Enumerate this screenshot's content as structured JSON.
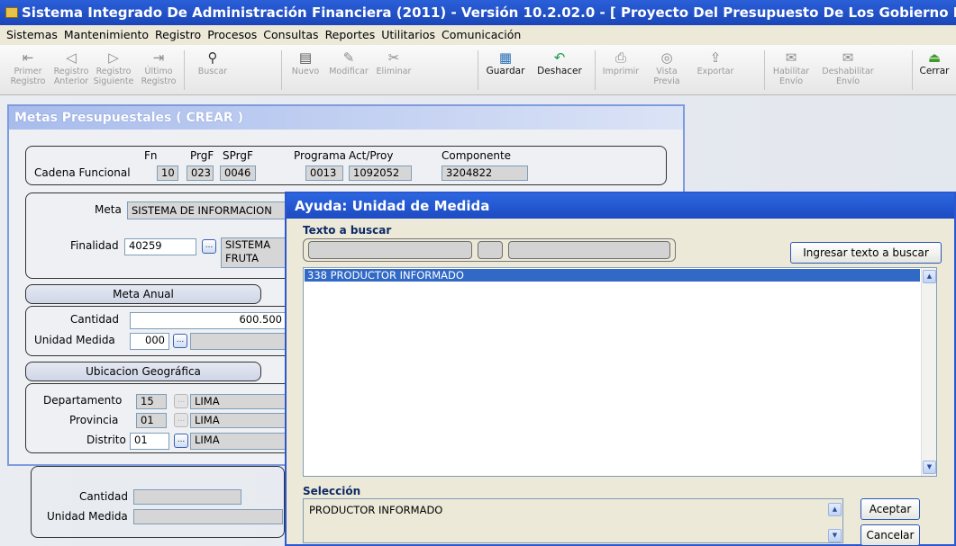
{
  "window": {
    "title": "Sistema Integrado De Administración Financiera (2011) - Versión 10.2.02.0 - [ Proyecto Del Presupuesto De Los Gobierno Locales ]"
  },
  "menu": [
    "Sistemas",
    "Mantenimiento",
    "Registro",
    "Procesos",
    "Consultas",
    "Reportes",
    "Utilitarios",
    "Comunicación"
  ],
  "toolbar": [
    {
      "l1": "Primer",
      "l2": "Registro",
      "icon": "⇤",
      "name": "first-record"
    },
    {
      "l1": "Registro",
      "l2": "Anterior",
      "icon": "◁",
      "name": "prev-record"
    },
    {
      "l1": "Registro",
      "l2": "Siguiente",
      "icon": "▷",
      "name": "next-record"
    },
    {
      "l1": "Último",
      "l2": "Registro",
      "icon": "⇥",
      "name": "last-record"
    },
    {
      "l1": "Buscar",
      "l2": "",
      "icon": "⚲",
      "name": "search"
    },
    {
      "l1": "Nuevo",
      "l2": "",
      "icon": "▤",
      "name": "new"
    },
    {
      "l1": "Modificar",
      "l2": "",
      "icon": "✎",
      "name": "edit"
    },
    {
      "l1": "Eliminar",
      "l2": "",
      "icon": "✂",
      "name": "delete"
    },
    {
      "l1": "Guardar",
      "l2": "",
      "icon": "▦",
      "name": "save"
    },
    {
      "l1": "Deshacer",
      "l2": "",
      "icon": "↶",
      "name": "undo"
    },
    {
      "l1": "Imprimir",
      "l2": "",
      "icon": "⎙",
      "name": "print"
    },
    {
      "l1": "Vista",
      "l2": "Previa",
      "icon": "◎",
      "name": "preview"
    },
    {
      "l1": "Exportar",
      "l2": "",
      "icon": "⇪",
      "name": "export"
    },
    {
      "l1": "Habilitar",
      "l2": "Envío",
      "icon": "✉",
      "name": "enable-send"
    },
    {
      "l1": "Deshabilitar",
      "l2": "Envío",
      "icon": "✉",
      "name": "disable-send"
    },
    {
      "l1": "Cerrar",
      "l2": "",
      "icon": "⏏",
      "name": "close"
    }
  ],
  "metas": {
    "title": "Metas Presupuestales ( CREAR )",
    "cadena": {
      "label": "Cadena Funcional",
      "fn_h": "Fn",
      "fn": "10",
      "prgf_h": "PrgF",
      "prgf": "023",
      "sprgf_h": "SPrgF",
      "sprgf": "0046",
      "programa_h": "Programa",
      "programa": "0013",
      "actproy_h": "Act/Proy",
      "actproy": "1092052",
      "componente_h": "Componente",
      "componente": "3204822"
    },
    "meta_label": "Meta",
    "meta_value": "SISTEMA DE INFORMACION",
    "finalidad_label": "Finalidad",
    "finalidad_code": "40259",
    "finalidad_desc_1": "SISTEMA",
    "finalidad_desc_2": "FRUTA",
    "meta_anual": "Meta Anual",
    "cantidad_label": "Cantidad",
    "cantidad_value": "600.500",
    "unidad_label": "Unidad Medida",
    "unidad_code": "000",
    "ubicacion": "Ubicacion Geográfica",
    "departamento_label": "Departamento",
    "departamento_code": "15",
    "departamento_name": "LIMA",
    "provincia_label": "Provincia",
    "provincia_code": "01",
    "provincia_name": "LIMA",
    "distrito_label": "Distrito",
    "distrito_code": "01",
    "distrito_name": "LIMA"
  },
  "lower": {
    "cantidad_label": "Cantidad",
    "unidad_label": "Unidad Medida"
  },
  "ayuda": {
    "title": "Ayuda: Unidad de Medida",
    "search_label": "Texto a buscar",
    "ingresar_button": "Ingresar texto a buscar",
    "list_item": "338  PRODUCTOR INFORMADO",
    "seleccion_label": "Selección",
    "seleccion_value": "PRODUCTOR INFORMADO",
    "aceptar": "Aceptar",
    "cancelar": "Cancelar"
  }
}
